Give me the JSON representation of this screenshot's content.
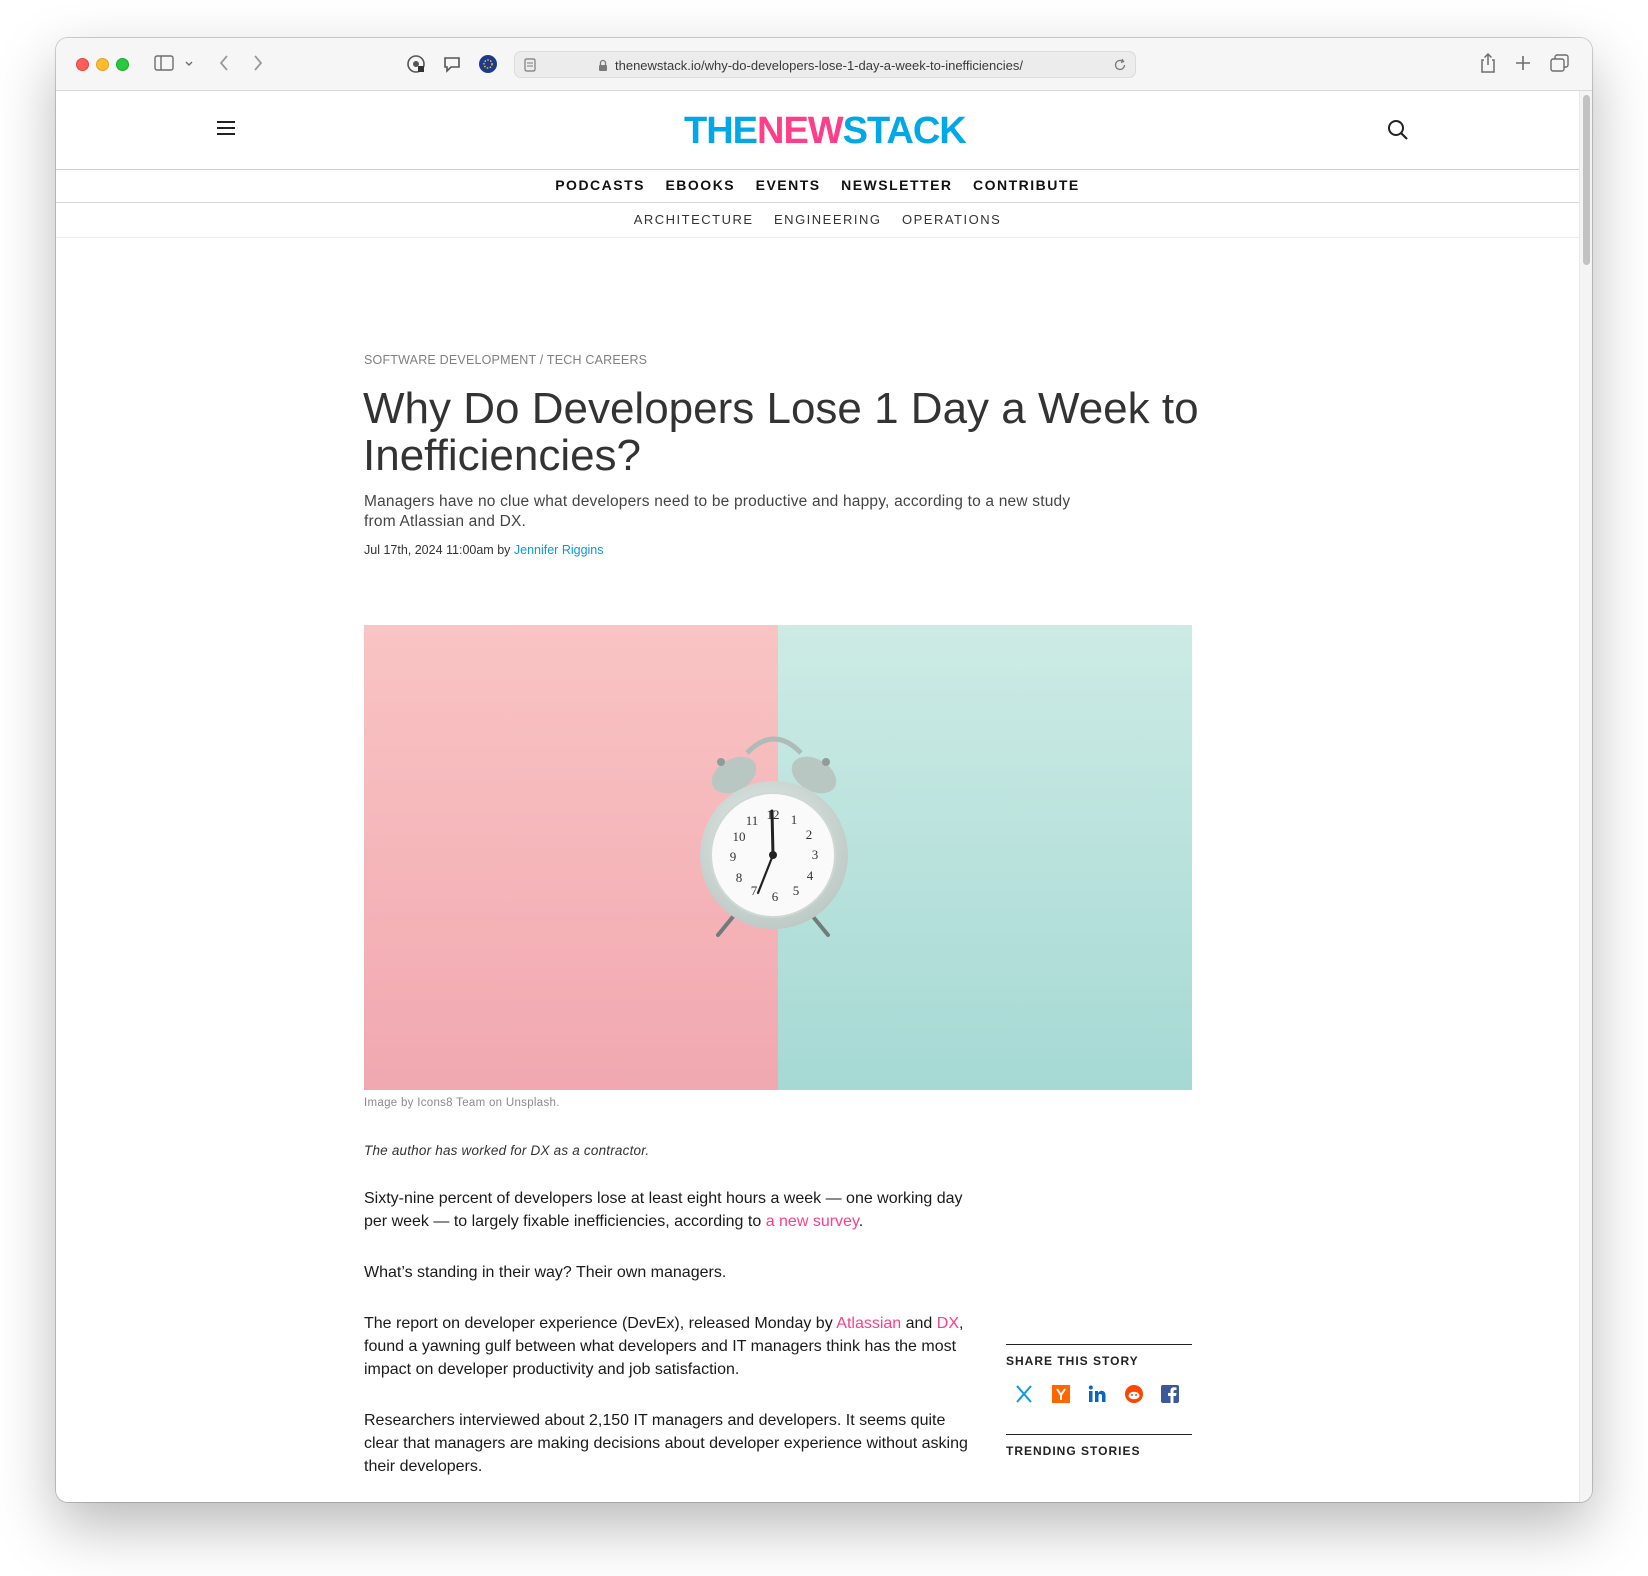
{
  "browser": {
    "url": "thenewstack.io/why-do-developers-lose-1-day-a-week-to-inefficiencies/"
  },
  "site": {
    "logo_the": "THE",
    "logo_new": "NEW",
    "logo_stack": "STACK",
    "nav_primary": [
      "PODCASTS",
      "EBOOKS",
      "EVENTS",
      "NEWSLETTER",
      "CONTRIBUTE"
    ],
    "nav_secondary": [
      "ARCHITECTURE",
      "ENGINEERING",
      "OPERATIONS"
    ],
    "colors": {
      "brand_blue": "#00a8e8",
      "brand_pink": "#ff3e8a"
    }
  },
  "article": {
    "breadcrumb": "SOFTWARE DEVELOPMENT / TECH CAREERS",
    "title": "Why Do Developers Lose 1 Day a Week to Inefficiencies?",
    "subtitle": "Managers have no clue what developers need to be productive and happy, according to a new study from Atlassian and DX.",
    "date": "Jul 17th, 2024 11:00am by ",
    "author": "Jennifer Riggins",
    "image_caption": "Image by Icons8 Team on Unsplash.",
    "disclosure": "The author has worked for DX as a contractor.",
    "p1_a": "Sixty-nine percent of developers lose at least eight hours a week — one working day per week — to largely fixable inefficiencies, according to ",
    "p1_link": "a new survey",
    "p1_b": ".",
    "p2": "What’s standing in their way? Their own managers.",
    "p3_a": "The report on developer experience (DevEx), released Monday by ",
    "p3_link1": "Atlassian",
    "p3_b": " and ",
    "p3_link2": "DX",
    "p3_c": ", found a yawning gulf between what developers and IT managers think has the most impact on developer productivity and job satisfaction.",
    "p4": "Researchers interviewed about 2,150 IT managers and developers. It seems quite clear that managers are making decisions about developer experience without asking their developers."
  },
  "sidebar": {
    "share_title": "SHARE THIS STORY",
    "share_icons": [
      "x-icon",
      "hacker-news-icon",
      "linkedin-icon",
      "reddit-icon",
      "facebook-icon"
    ],
    "trending_title": "TRENDING STORIES"
  }
}
